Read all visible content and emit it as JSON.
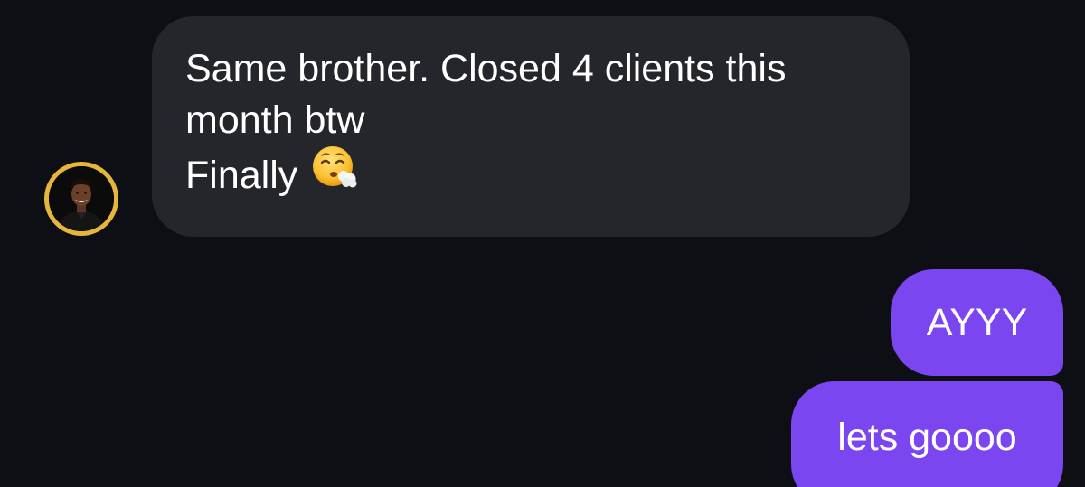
{
  "colors": {
    "background": "#0d0f14",
    "incoming_bubble": "#24262b",
    "outgoing_bubble": "#7b45f0",
    "avatar_ring": "#e6b53c",
    "text": "#ffffff"
  },
  "messages": {
    "incoming": {
      "line1": "Same brother. Closed 4 clients this",
      "line2": "month btw",
      "line3": "Finally",
      "emoji": "face-exhaling-emoji"
    },
    "outgoing": [
      {
        "text": "AYYY"
      },
      {
        "text": "lets goooo"
      }
    ]
  },
  "avatar": {
    "icon": "user-avatar-photo"
  }
}
